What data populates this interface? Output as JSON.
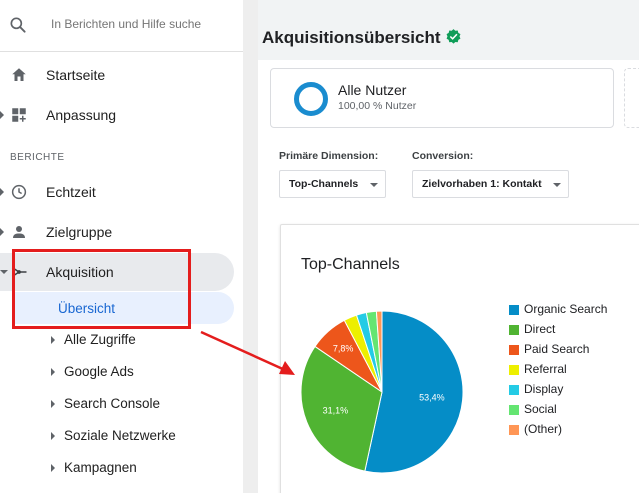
{
  "search": {
    "placeholder": "In Berichten und Hilfe suche"
  },
  "nav": {
    "home": "Startseite",
    "custom": "Anpassung",
    "section": "BERICHTE",
    "realtime": "Echtzeit",
    "audience": "Zielgruppe",
    "acquisition": "Akquisition",
    "overview": "Übersicht",
    "sub_items": [
      "Alle Zugriffe",
      "Google Ads",
      "Search Console",
      "Soziale Netzwerke",
      "Kampagnen"
    ]
  },
  "page": {
    "title": "Akquisitionsübersicht",
    "segment_title": "Alle Nutzer",
    "segment_sub": "100,00 % Nutzer",
    "primary_dimension_label": "Primäre Dimension:",
    "primary_dimension_value": "Top-Channels",
    "conversion_label": "Conversion:",
    "conversion_value": "Zielvorhaben 1: Kontakt"
  },
  "colors": {
    "accent": "#1a8ccf",
    "active_text": "#1967d2",
    "highlight_red": "#e41d1d",
    "verified_green": "#0f9d58"
  },
  "icons": [
    "search-icon",
    "home-icon",
    "dashboard-icon",
    "clock-icon",
    "person-icon",
    "acquisition-icon",
    "verified-check-icon"
  ],
  "chart_data": {
    "type": "pie",
    "title": "Top-Channels",
    "series": [
      {
        "name": "Organic Search",
        "value": 53.4,
        "label": "53,4%",
        "color": "#058dc7"
      },
      {
        "name": "Direct",
        "value": 31.1,
        "label": "31,1%",
        "color": "#50b432"
      },
      {
        "name": "Paid Search",
        "value": 7.8,
        "label": "7,8%",
        "color": "#ed561b"
      },
      {
        "name": "Referral",
        "value": 2.6,
        "label": "",
        "color": "#edef00"
      },
      {
        "name": "Display",
        "value": 2.0,
        "label": "",
        "color": "#24cbe5"
      },
      {
        "name": "Social",
        "value": 2.0,
        "label": "",
        "color": "#64e572"
      },
      {
        "name": "(Other)",
        "value": 1.1,
        "label": "",
        "color": "#ff9655"
      }
    ],
    "legend_position": "right"
  }
}
